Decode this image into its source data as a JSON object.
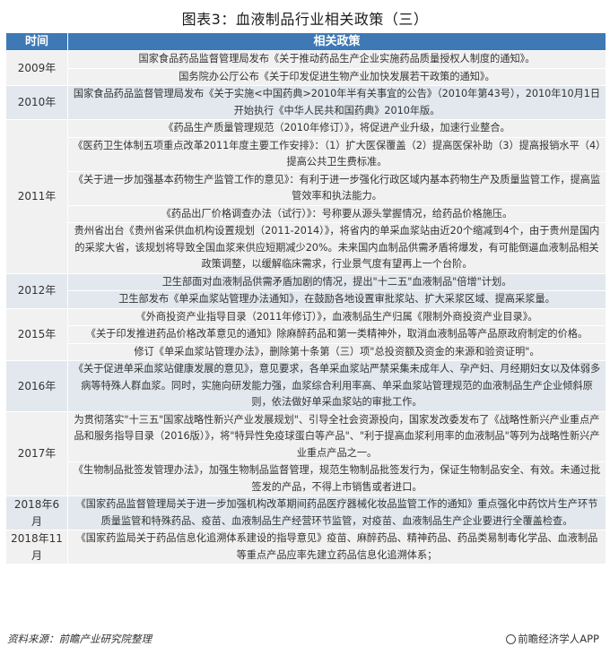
{
  "title": "图表3：血液制品行业相关政策（三）",
  "table": {
    "headers": [
      "时间",
      "相关政策"
    ],
    "groups": [
      {
        "year": "2009年",
        "items": [
          "国家食品药品监督管理局发布《关于推动药品生产企业实施药品质量授权人制度的通知》。",
          "国务院办公厅公布《关于印发促进生物产业加快发展若干政策的通知》。"
        ]
      },
      {
        "year": "2010年",
        "items": [
          "国家食品药品监督管理局发布《关于实施<中国药典>2010年半有关事宜的公告》（2010年第43号），2010年10月1日开始执行《中华人民共和国药典》2010年版。"
        ]
      },
      {
        "year": "2011年",
        "items": [
          "《药品生产质量管理规范（2010年修订）》，将促进产业升级，加速行业整合。",
          "《医药卫生体制五项重点改革2011年度主要工作安排》：（1）扩大医保覆盖（2）提高医保补助（3）提高报销水平（4）提高公共卫生费标准。",
          "《关于进一步加强基本药物生产监管工作的意见》：有利于进一步强化行政区域内基本药物生产及质量监管工作，提高监管效率和执法能力。",
          "《药品出厂价格调查办法（试行）》：号称要从源头掌握情况，给药品价格施压。",
          "贵州省出台《贵州省采供血机构设置规划（2011-2014）》，将省内的单采血浆站由近20个缩减到4个，由于贵州是国内的采浆大省，该规划将导致全国血浆来供应短期减少20%。未来国内血制品供需矛盾将爆发，有可能倒逼血液制品相关政策调整，以缓解临床需求，行业景气度有望再上一个台阶。"
        ]
      },
      {
        "year": "2012年",
        "items": [
          "卫生部面对血液制品供需矛盾加剧的情况，提出\"十二五\"血液制品\"倍增\"计划。",
          "卫生部发布《单采血浆站管理办法通知》，在鼓励各地设置审批浆站、扩大采浆区域、提高采浆量。"
        ]
      },
      {
        "year": "2015年",
        "items": [
          "《外商投资产业指导目录（2011年修订）》，血液制品生产归属《限制外商投资产业目录》。",
          "《关于印发推进药品价格改革意见的通知》除麻醉药品和第一类精神外，取消血液制品等产品原政府制定的价格。",
          "修订《单采血浆站管理办法》，删除第十条第（三）项\"总投资额及资金的来源和验资证明\"。"
        ]
      },
      {
        "year": "2016年",
        "items": [
          "《关于促进单采血浆站健康发展的意见》，意见要求，各单采血浆站严禁采集未成年人、孕产妇、月经期妇女以及体弱多病等特殊人群血浆。同时，实施向研发能力强，血浆综合利用率高、单采血浆站管理规范的血液制品生产企业倾斜原则，依法做好单采血浆站的审批工作。"
        ]
      },
      {
        "year": "2017年",
        "items": [
          "为贯彻落实\"十三五\"国家战略性新兴产业发展规划\"、引导全社会资源投向，国家发改委发布了《战略性新兴产业重点产品和服务指导目录（2016版）》，将\"特异性免疫球蛋白等产品\"、\"利于提高血浆利用率的血液制品\"等列为战略性新兴产业重点产品之一。",
          "《生物制品批签发管理办法》，加强生物制品监督管理，规范生物制品批签发行为，保证生物制品安全、有效。未通过批签发的产品，不得上市销售或者进口。"
        ]
      },
      {
        "year": "2018年6月",
        "items": [
          "《国家药品监督管理局关于进一步加强机构改革期间药品医疗器械化妆品监管工作的通知》重点强化中药饮片生产环节质量监管和特殊药品、疫苗、血液制品生产经营环节监管，对疫苗、血液制品生产企业要进行全覆盖检查。"
        ]
      },
      {
        "year": "2018年11月",
        "items": [
          "《国家药监局关于药品信息化追溯体系建设的指导意见》疫苗、麻醉药品、精神药品、药品类易制毒化学品、血液制品等重点产品应率先建立药品信息化追溯体系；"
        ]
      }
    ]
  },
  "footer": {
    "source": "资料来源：前瞻产业研究院整理",
    "brand": "前瞻经济学人APP"
  },
  "colors": {
    "header_bg": "#3e79b5",
    "band_a": "#f1f1f1",
    "band_b": "#e3e8ee"
  }
}
